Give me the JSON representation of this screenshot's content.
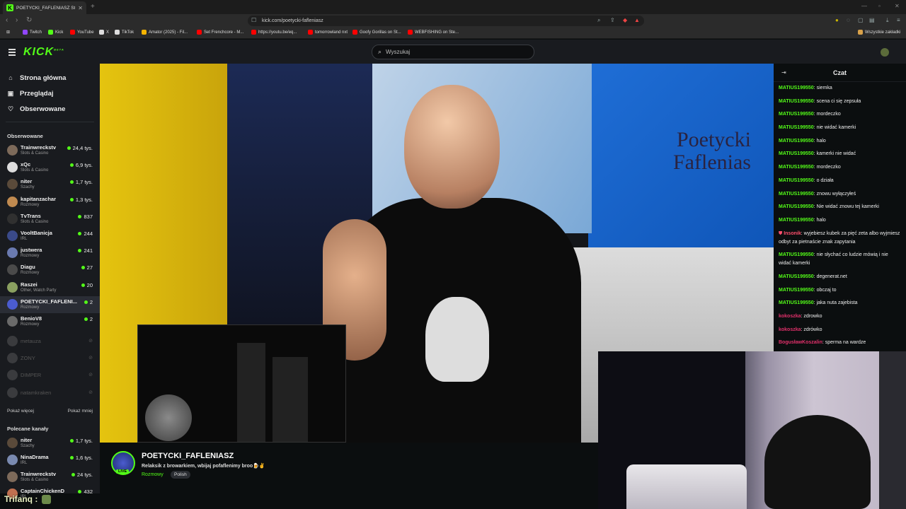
{
  "browser": {
    "tab_title": "POETYCKI_FAFLENIASZ Strea...",
    "url": "kick.com/poetycki-fafleniasz",
    "bookmarks": [
      {
        "label": "Twitch",
        "color": "#9146ff"
      },
      {
        "label": "Kick",
        "color": "#53fc18"
      },
      {
        "label": "YouTube",
        "color": "#ff0000"
      },
      {
        "label": "X",
        "color": "#dddddd"
      },
      {
        "label": "TikTok",
        "color": "#dddddd"
      },
      {
        "label": "Amator (2025) - Fil...",
        "color": "#f5b400"
      },
      {
        "label": "Set Frenchcore - M...",
        "color": "#ff0000"
      },
      {
        "label": "https://youtu.be/eq...",
        "color": "#ff0000"
      },
      {
        "label": "tomorrowland nxt",
        "color": "#ff0000"
      },
      {
        "label": "Goofy Gorillas on St...",
        "color": "#ff0000"
      },
      {
        "label": "WEBFISHING on Ste...",
        "color": "#ff0000"
      }
    ],
    "bookmarks_all": "Wszystkie zakładki"
  },
  "header": {
    "logo": "KICK",
    "beta": "BETA",
    "search_placeholder": "Wyszukaj"
  },
  "sidebar": {
    "nav": [
      {
        "label": "Strona główna",
        "icon": "home-icon"
      },
      {
        "label": "Przeglądaj",
        "icon": "browse-icon"
      },
      {
        "label": "Obserwowane",
        "icon": "heart-icon"
      }
    ],
    "followed_title": "Obserwowane",
    "followed": [
      {
        "name": "Trainwreckstv",
        "category": "Slots & Casino",
        "viewers": "24,4 tys.",
        "color": "#7d6a5a"
      },
      {
        "name": "xQc",
        "category": "Slots & Casino",
        "viewers": "6,9 tys.",
        "color": "#dddddd"
      },
      {
        "name": "niter",
        "category": "Szachy",
        "viewers": "1,7 tys.",
        "color": "#5a4a3a"
      },
      {
        "name": "kapitanzachar",
        "category": "Rozmowy",
        "viewers": "1,3 tys.",
        "color": "#c08a50"
      },
      {
        "name": "TvTrans",
        "category": "Slots & Casino",
        "viewers": "837",
        "color": "#303030"
      },
      {
        "name": "VooltBanicja",
        "category": "IRL",
        "viewers": "244",
        "color": "#3a4a8a"
      },
      {
        "name": "justwera",
        "category": "Rozmowy",
        "viewers": "241",
        "color": "#6a7ab0"
      },
      {
        "name": "Diagu",
        "category": "Rozmowy",
        "viewers": "27",
        "color": "#4a4a4a"
      },
      {
        "name": "Raszei",
        "category": "Other, Watch Party",
        "viewers": "20",
        "color": "#8aa060"
      },
      {
        "name": "POETYCKI_FAFLENI...",
        "category": "Rozmowy",
        "viewers": "2",
        "color": "#4b5ccf"
      },
      {
        "name": "BenioV8",
        "category": "Rozmowy",
        "viewers": "2",
        "color": "#6a6a6a"
      }
    ],
    "offline": [
      {
        "name": "metauza"
      },
      {
        "name": "ZONY"
      },
      {
        "name": "DIMPER"
      },
      {
        "name": "natamkraken"
      }
    ],
    "show_more": "Pokaż więcej",
    "show_less": "Pokaż mniej",
    "recommended_title": "Polecane kanały",
    "recommended": [
      {
        "name": "niter",
        "category": "Szachy",
        "viewers": "1,7 tys.",
        "color": "#5a4a3a"
      },
      {
        "name": "NinaDrama",
        "category": "IRL",
        "viewers": "1,6 tys.",
        "color": "#7a8ab0"
      },
      {
        "name": "Trainwreckstv",
        "category": "Slots & Casino",
        "viewers": "24 tys.",
        "color": "#7d6a5a"
      },
      {
        "name": "CaptainChickenD",
        "category": "IRL",
        "viewers": "432",
        "color": "#c07050"
      }
    ]
  },
  "video": {
    "sign_line1": "Poetycki",
    "sign_line2": "Faflenias"
  },
  "stream": {
    "name": "POETYCKI_FAFLENIASZ",
    "title": "Relaksik z browarkiem, wbijaj pofaflenimy broo🍺✌",
    "category": "Rozmowy",
    "tag": "Polish",
    "live": "LIVE"
  },
  "chat": {
    "title": "Czat",
    "messages": [
      {
        "user": "MATIUS199550",
        "color": "#53fc18",
        "text": "siemka"
      },
      {
        "user": "MATIUS199550",
        "color": "#53fc18",
        "text": "scena ci się zepsuła"
      },
      {
        "user": "MATIUS199550",
        "color": "#53fc18",
        "text": "mordeczko"
      },
      {
        "user": "MATIUS199550",
        "color": "#53fc18",
        "text": "nie widać kamerki"
      },
      {
        "user": "MATIUS199550",
        "color": "#53fc18",
        "text": "halo"
      },
      {
        "user": "MATIUS199550",
        "color": "#53fc18",
        "text": "kamerki nie widać"
      },
      {
        "user": "MATIUS199550",
        "color": "#53fc18",
        "text": "mordeczko"
      },
      {
        "user": "MATIUS199550",
        "color": "#53fc18",
        "text": "o działa"
      },
      {
        "user": "MATIUS199550",
        "color": "#53fc18",
        "text": "znowu wyłączyłeś"
      },
      {
        "user": "MATIUS199550",
        "color": "#53fc18",
        "text": "Nie widać znowu tej kamerki"
      },
      {
        "user": "MATIUS199550",
        "color": "#53fc18",
        "text": "halo"
      },
      {
        "user": "Insonik",
        "color": "#ff4f6d",
        "text": "wyjebiesz kubek za pięć zeta albo wyjmiesz odbyt za pietnaście znak zapytania"
      },
      {
        "user": "MATIUS199550",
        "color": "#53fc18",
        "text": "nie słychać co ludzie mówią i nie widać kamerki"
      },
      {
        "user": "MATIUS199550",
        "color": "#53fc18",
        "text": "degenerat.net"
      },
      {
        "user": "MATIUS199550",
        "color": "#53fc18",
        "text": "obczaj to"
      },
      {
        "user": "MATIUS199550",
        "color": "#53fc18",
        "text": "jaka nuta zajebista"
      },
      {
        "user": "kokoszka",
        "color": "#e0306a",
        "text": "zdrowko"
      },
      {
        "user": "kokoszka",
        "color": "#e0306a",
        "text": "zdrówko"
      },
      {
        "user": "BogusławKoszalin",
        "color": "#e0306a",
        "text": "sperma na wardze"
      }
    ]
  },
  "overlay": {
    "trifanq": "Trifanq :"
  }
}
